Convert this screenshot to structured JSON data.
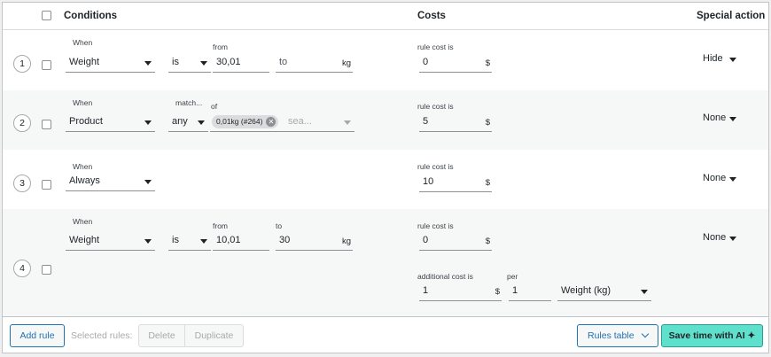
{
  "header": {
    "conditions": "Conditions",
    "costs": "Costs",
    "special_action": "Special action"
  },
  "rows": [
    {
      "number": "1",
      "when_label": "When",
      "when_value": "Weight",
      "op_value": "is",
      "from_label": "from",
      "from_value": "30,01",
      "to_placeholder": "to",
      "to_unit": "kg",
      "cost_label": "rule cost is",
      "cost_value": "0",
      "cost_unit": "$",
      "special": "Hide"
    },
    {
      "number": "2",
      "when_label": "When",
      "when_value": "Product",
      "match_label": "match...",
      "match_value": "any",
      "of_label": "of",
      "chip": "0,01kg (#264)",
      "search_placeholder": "sea...",
      "cost_label": "rule cost is",
      "cost_value": "5",
      "cost_unit": "$",
      "special": "None"
    },
    {
      "number": "3",
      "when_label": "When",
      "when_value": "Always",
      "cost_label": "rule cost is",
      "cost_value": "10",
      "cost_unit": "$",
      "special": "None"
    },
    {
      "number": "4",
      "when_label": "When",
      "when_value": "Weight",
      "op_value": "is",
      "from_label": "from",
      "from_value": "10,01",
      "to_label": "to",
      "to_value": "30",
      "to_unit": "kg",
      "cost_label": "rule cost is",
      "cost_value": "0",
      "cost_unit": "$",
      "additional_label": "additional cost is",
      "additional_value": "1",
      "additional_unit": "$",
      "per_label": "per",
      "per_value": "1",
      "per_unit_value": "Weight (kg)",
      "special": "None"
    }
  ],
  "footer": {
    "add_rule": "Add rule",
    "selected_rules": "Selected rules:",
    "delete": "Delete",
    "duplicate": "Duplicate",
    "rules_table": "Rules table",
    "ai_button": "Save time with AI ✦"
  }
}
